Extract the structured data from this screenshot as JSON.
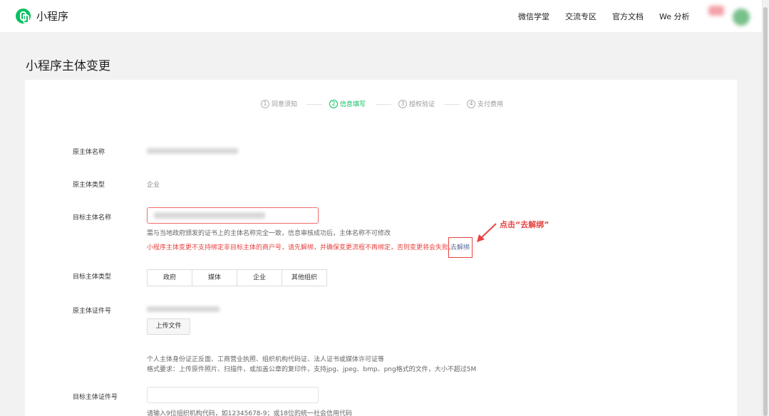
{
  "header": {
    "logo_text": "小程序",
    "nav": [
      "微信学堂",
      "交流专区",
      "官方文档",
      "We 分析"
    ]
  },
  "page_title": "小程序主体变更",
  "steps": [
    {
      "num": "1",
      "label": "同意须知"
    },
    {
      "num": "2",
      "label": "信息填写"
    },
    {
      "num": "3",
      "label": "授权验证"
    },
    {
      "num": "4",
      "label": "支付费用"
    }
  ],
  "form": {
    "orig_name_label": "原主体名称",
    "orig_type_label": "原主体类型",
    "orig_type_value": "企业",
    "target_name_label": "目标主体名称",
    "target_name_hint": "需与当地政府颁发的证书上的主体名称完全一致，信息审核成功后，主体名称不可修改",
    "target_name_warning": "小程序主体变更不支持绑定非目标主体的商户号，请先解绑，并确保变更流程不再绑定，否则变更将会失败。",
    "unbind_link": "去解绑",
    "annotation": "点击“去解绑”",
    "target_type_label": "目标主体类型",
    "target_type_options": [
      "政府",
      "媒体",
      "企业",
      "其他组织"
    ],
    "orig_cert_label": "原主体证件号",
    "upload_button": "上传文件",
    "upload_hint_1": "个人主体身份证正反面、工商营业执照、组织机构代码证、法人证书或媒体许可证等",
    "upload_hint_2": "格式要求：上传原件照片、扫描件，或加盖公章的复印件，支持jpg、jpeg、bmp、png格式的文件，大小不超过5M",
    "target_cert_label": "目标主体证件号",
    "target_cert_hint": "请输入9位组织机构代码，如12345678-9；或18位的统一社会信用代码"
  },
  "colors": {
    "accent": "#07c160",
    "error": "#e64340",
    "link": "#576b95"
  }
}
